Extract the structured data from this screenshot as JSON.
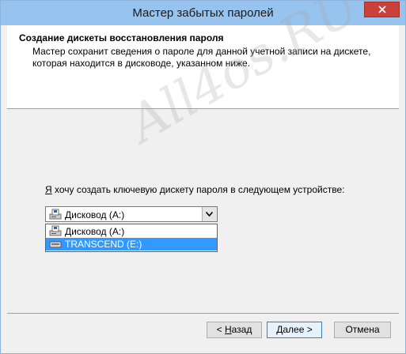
{
  "window": {
    "title": "Мастер забытых паролей"
  },
  "header": {
    "title": "Создание дискеты восстановления пароля",
    "description": "Мастер сохранит сведения о пароле для данной учетной записи на дискете, которая находится в дисководе, указанном ниже."
  },
  "content": {
    "prompt_accel": "Я",
    "prompt_rest": " хочу создать ключевую дискету пароля в следующем устройстве:",
    "combo": {
      "selected": "Дисковод (A:)"
    },
    "options": [
      {
        "label": "Дисковод (A:)",
        "icon": "floppy-drive-icon",
        "selected": false
      },
      {
        "label": "TRANSCEND (E:)",
        "icon": "removable-drive-icon",
        "selected": true
      }
    ]
  },
  "watermark": "All4os.RU",
  "buttons": {
    "back_accel": "Н",
    "back_pre": "< ",
    "back_post": "азад",
    "next_accel": "Д",
    "next_post": "алее >",
    "cancel": "Отмена"
  },
  "colors": {
    "titlebar": "#97c3ef",
    "close": "#c9413a",
    "selection": "#3399ff"
  }
}
